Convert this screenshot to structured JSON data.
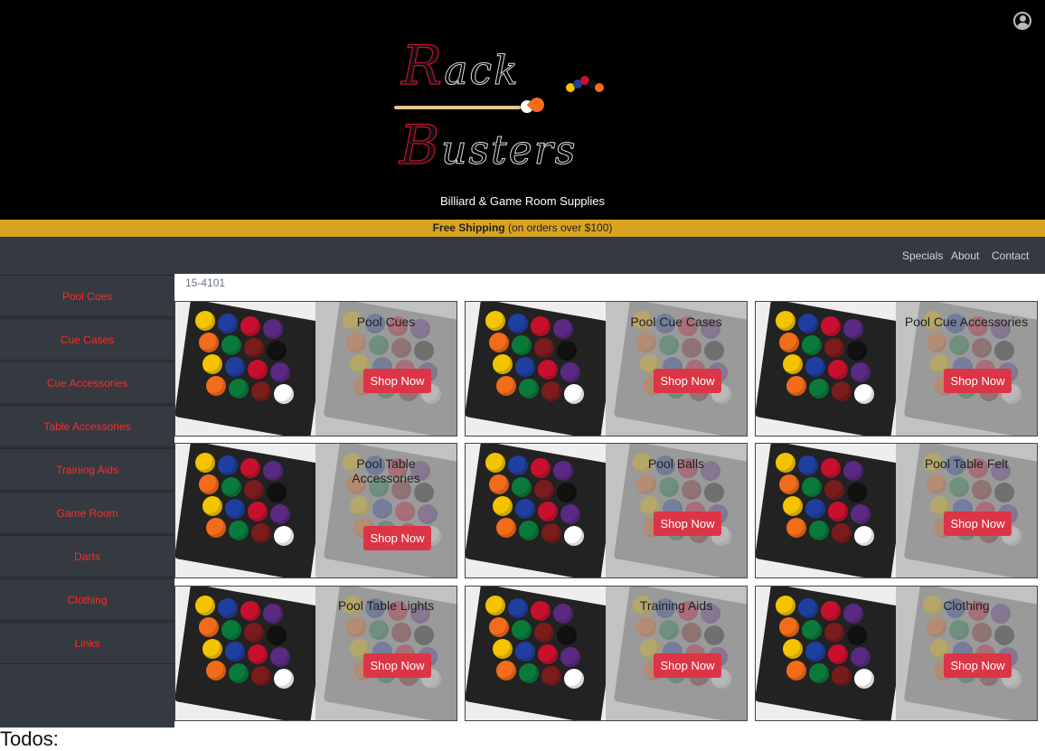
{
  "header": {
    "logo_alt": "Rack Busters",
    "tagline": "Billiard & Game Room Supplies"
  },
  "shipping": {
    "bold": "Free Shipping",
    "rest": "(on orders over $100)"
  },
  "topnav": {
    "items": [
      "Specials",
      "About",
      "Contact"
    ]
  },
  "sidebar": {
    "items": [
      "Pool Cues",
      "Cue Cases",
      "Cue Accessories",
      "Table Accessories",
      "Training Aids",
      "Game Room",
      "Darts",
      "Clothing",
      "Links"
    ]
  },
  "breadcrumb": "15-4101",
  "cards": [
    {
      "title": "Pool Cues",
      "button": "Shop Now"
    },
    {
      "title": "Pool Cue Cases",
      "button": "Shop Now"
    },
    {
      "title": "Pool Cue Accessories",
      "button": "Shop Now"
    },
    {
      "title": "Pool Table Accessories",
      "button": "Shop Now"
    },
    {
      "title": "Pool Balls",
      "button": "Shop Now"
    },
    {
      "title": "Pool Table Felt",
      "button": "Shop Now"
    },
    {
      "title": "Pool Table Lights",
      "button": "Shop Now"
    },
    {
      "title": "Training Aids",
      "button": "Shop Now"
    },
    {
      "title": "Clothing",
      "button": "Shop Now"
    }
  ],
  "footer_text": "Todos:",
  "colors": {
    "accent": "#dc3545",
    "nav_bg": "#343a40",
    "shipbar": "#d8a321",
    "sidebar_link": "#ff2a2a"
  },
  "icons": {
    "account": "user-circle-icon"
  }
}
